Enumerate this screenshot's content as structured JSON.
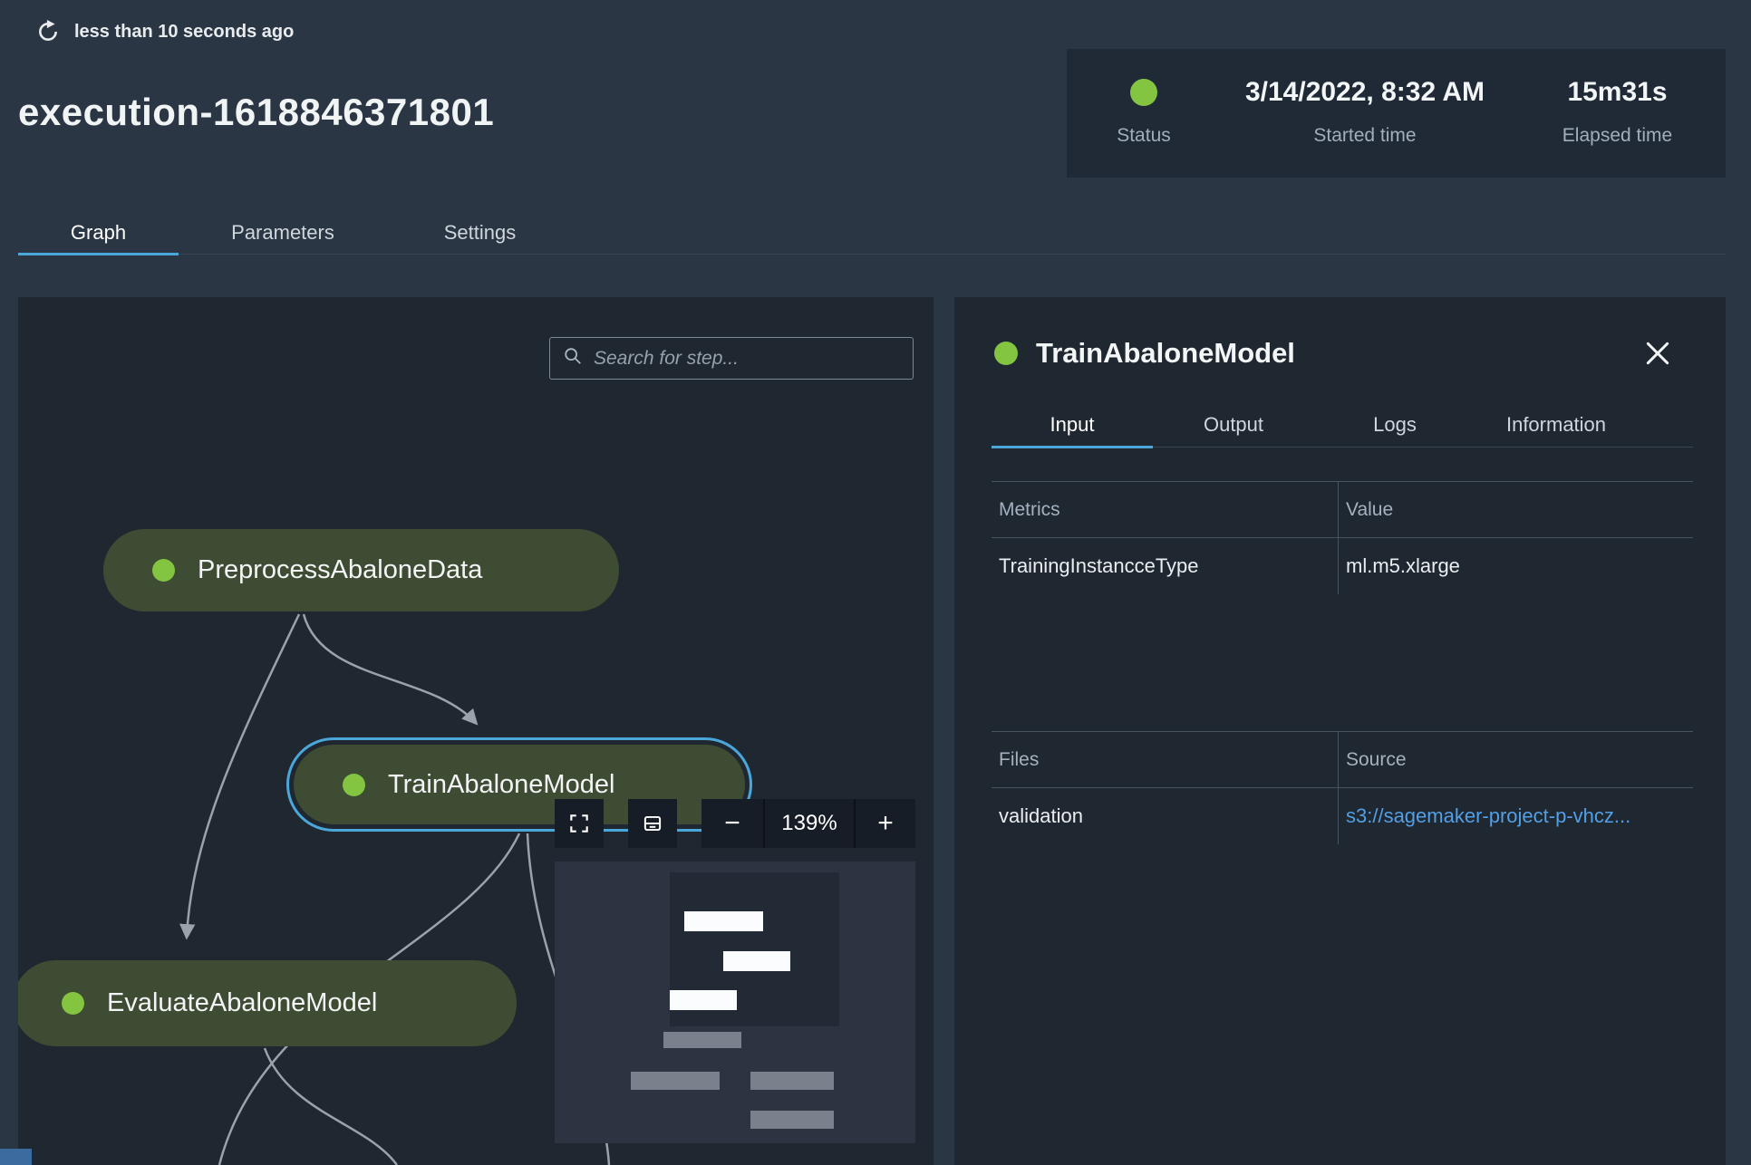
{
  "colors": {
    "page_bg": "#2b3644",
    "panel_bg": "#1f2731",
    "card_bg": "#202a37",
    "node_bg": "#3d4c32",
    "status_green": "#83c440",
    "selection_blue": "#4ba7d9",
    "link_blue": "#539fe5",
    "edge_gray": "#9aa2ab"
  },
  "header": {
    "refreshed_text": "less than 10 seconds ago",
    "title": "execution-1618846371801",
    "status_card": {
      "status_label": "Status",
      "started_label": "Started time",
      "started_value": "3/14/2022, 8:32 AM",
      "elapsed_label": "Elapsed time",
      "elapsed_value": "15m31s"
    },
    "tabs": {
      "graph": "Graph",
      "parameters": "Parameters",
      "settings": "Settings"
    }
  },
  "graph": {
    "search_placeholder": "Search for step...",
    "nodes": {
      "preprocess": "PreprocessAbaloneData",
      "train": "TrainAbaloneModel",
      "evaluate": "EvaluateAbaloneModel"
    },
    "zoom": {
      "minus": "−",
      "level": "139%",
      "plus": "+"
    }
  },
  "details": {
    "title": "TrainAbaloneModel",
    "tabs": {
      "input": "Input",
      "output": "Output",
      "logs": "Logs",
      "information": "Information"
    },
    "metrics": {
      "col1": "Metrics",
      "col2": "Value",
      "row1_key": "TrainingInstancceType",
      "row1_value": "ml.m5.xlarge"
    },
    "files": {
      "col1": "Files",
      "col2": "Source",
      "row1_key": "validation",
      "row1_value": "s3://sagemaker-project-p-vhcz..."
    }
  }
}
